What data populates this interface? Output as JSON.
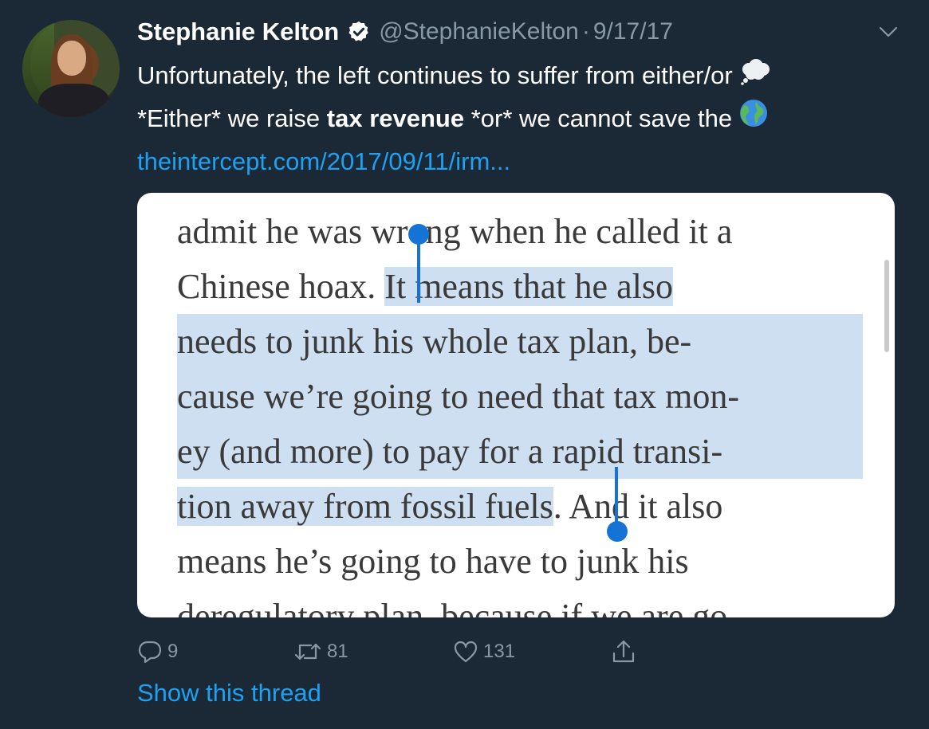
{
  "author": {
    "name": "Stephanie Kelton",
    "handle": "@StephanieKelton",
    "separator": "·",
    "date": "9/17/17",
    "verified": true,
    "avatar_icon": "profile-photo"
  },
  "tweet": {
    "line1": "Unfortunately, the left continues to suffer from either/or",
    "line1_emoji": "thought-balloon-emoji",
    "line2_part1": "*Either* we raise ",
    "line2_bold": "tax revenue",
    "line2_part2": " *or* we cannot save the",
    "line2_emoji": "globe-emoji",
    "link": "theintercept.com/2017/09/11/irm..."
  },
  "article_excerpt": {
    "line1": "admit he was wrong when he called it a",
    "line2_plain": "Chinese hoax. ",
    "line2_highlight": "It means that he also",
    "line3": "needs to junk his whole tax plan, be-",
    "line4": "cause we’re going to need that tax mon-",
    "line5": "ey (and more) to pay for a rapid transi-",
    "line6_highlight": "tion away from fossil fuels",
    "line6_plain": ". And it also",
    "line7": "means he’s going to have to junk his",
    "line8": "deregulatory plan, because if we are go-"
  },
  "actions": {
    "reply_count": "9",
    "retweet_count": "81",
    "like_count": "131"
  },
  "show_thread": "Show this thread",
  "colors": {
    "background": "#1b2836",
    "accent": "#1da1f2",
    "muted": "#8899a6",
    "selection": "#cddff0",
    "selection_handle": "#1673d6"
  }
}
